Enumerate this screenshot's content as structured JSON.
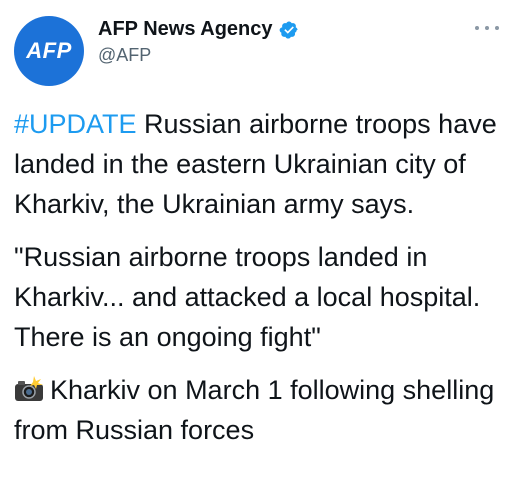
{
  "author": {
    "avatar_text": "AFP",
    "display_name": "AFP News Agency",
    "handle": "@AFP",
    "verified": true,
    "avatar_color": "#1c72d8"
  },
  "menu_icon": "more-horizontal-icon",
  "tweet": {
    "hashtag": "#UPDATE",
    "para1_rest": " Russian airborne troops have landed in the eastern Ukrainian city of Kharkiv, the Ukrainian army says.",
    "para2": "\"Russian airborne troops landed in Kharkiv... and attacked a local hospital. There is an ongoing fight\"",
    "camera_emoji": "camera-flash-icon",
    "para3": "Kharkiv on March 1 following shelling from Russian forces"
  },
  "colors": {
    "hashtag": "#1d9bf0",
    "verified_badge": "#1d9bf0",
    "handle": "#536471"
  }
}
